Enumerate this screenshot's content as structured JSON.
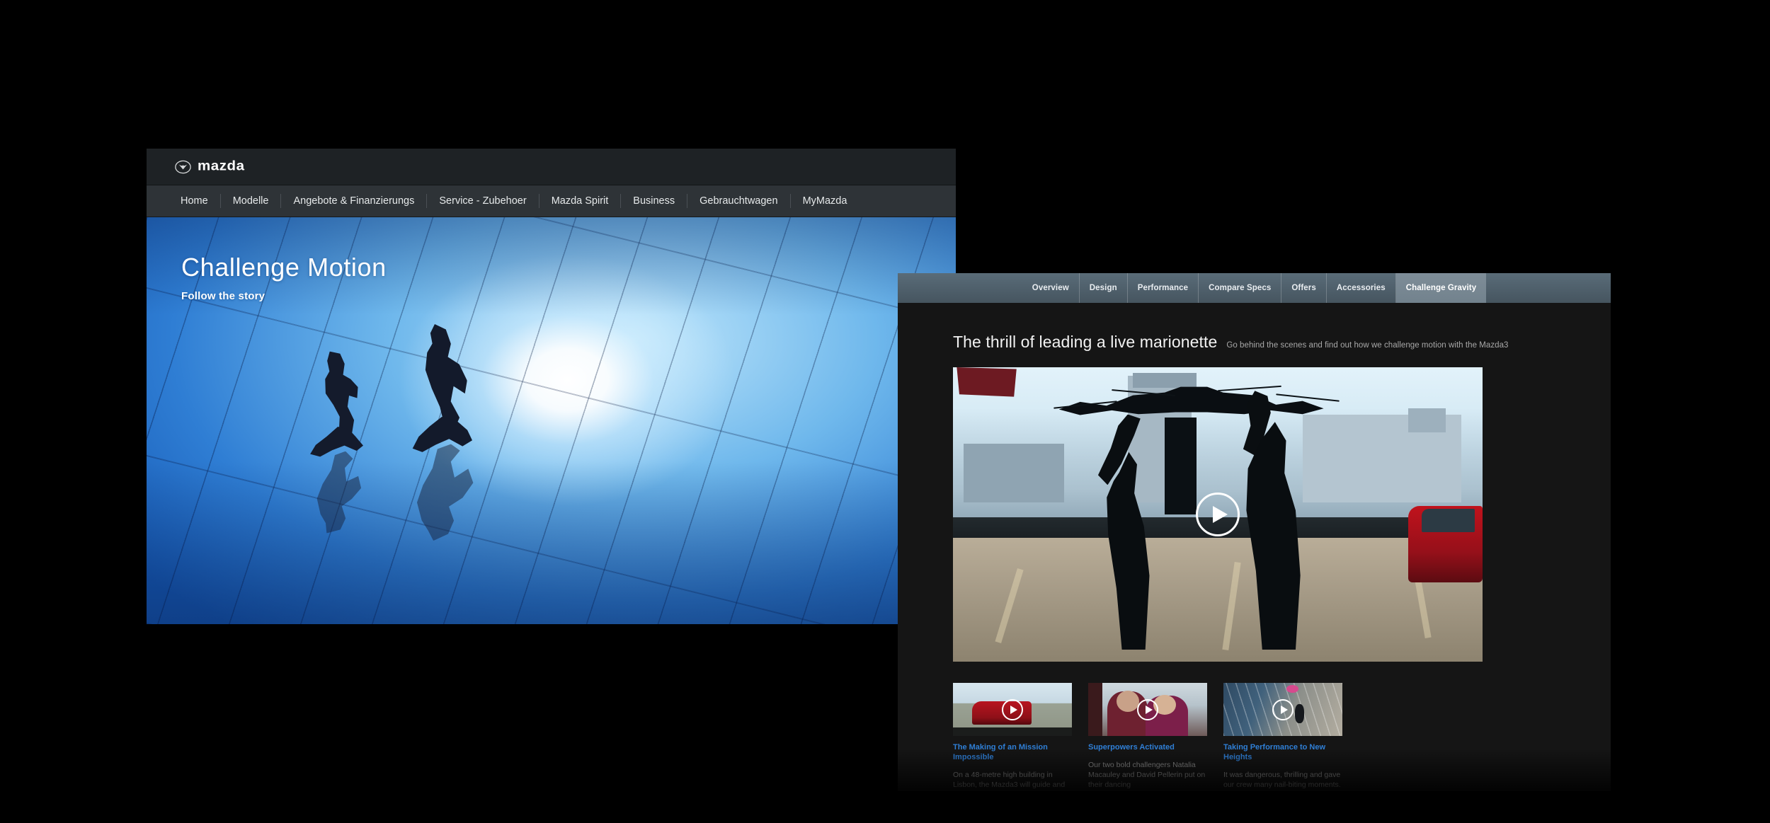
{
  "window_homepage": {
    "brand": {
      "wordmark": "mazda",
      "logo_icon": "mazda-logo-icon"
    },
    "nav_items": [
      {
        "label": "Home"
      },
      {
        "label": "Modelle"
      },
      {
        "label": "Angebote & Finanzierungs"
      },
      {
        "label": "Service - Zubehoer"
      },
      {
        "label": "Mazda Spirit"
      },
      {
        "label": "Business"
      },
      {
        "label": "Gebrauchtwagen"
      },
      {
        "label": "MyMazda"
      }
    ],
    "hero": {
      "title": "Challenge Motion",
      "subtitle": "Follow the story"
    }
  },
  "window_challenge": {
    "tabs": [
      {
        "label": "Overview",
        "active": false
      },
      {
        "label": "Design",
        "active": false
      },
      {
        "label": "Performance",
        "active": false
      },
      {
        "label": "Compare Specs",
        "active": false
      },
      {
        "label": "Offers",
        "active": false
      },
      {
        "label": "Accessories",
        "active": false
      },
      {
        "label": "Challenge Gravity",
        "active": true
      }
    ],
    "heading": "The thrill of leading a live marionette",
    "subheading": "Go behind the scenes and find out how we challenge motion with the Mazda3",
    "player": {
      "play_icon": "play-icon"
    },
    "videos": [
      {
        "title": "The Making of an Mission Impossible",
        "body": "On a 48-metre high building in Lisbon, the Mazda3 will guide and choreograph the",
        "play_icon": "play-icon"
      },
      {
        "title": "Superpowers Activated",
        "body": "Our two bold challengers Natalia Macauley and David Pellerin put on their dancing",
        "play_icon": "play-icon"
      },
      {
        "title": "Taking Performance to New Heights",
        "body": "It was dangerous, thrilling and gave our crew many nail-biting moments. But in the",
        "play_icon": "play-icon"
      }
    ]
  },
  "colors": {
    "page_background": "#000000",
    "topbar": "#1e2225",
    "navbar": "#2e3337",
    "tabbar": "#51626e",
    "tab_active": "#78868f",
    "link_blue": "#2f7fd6",
    "panel_dark": "#151515"
  }
}
